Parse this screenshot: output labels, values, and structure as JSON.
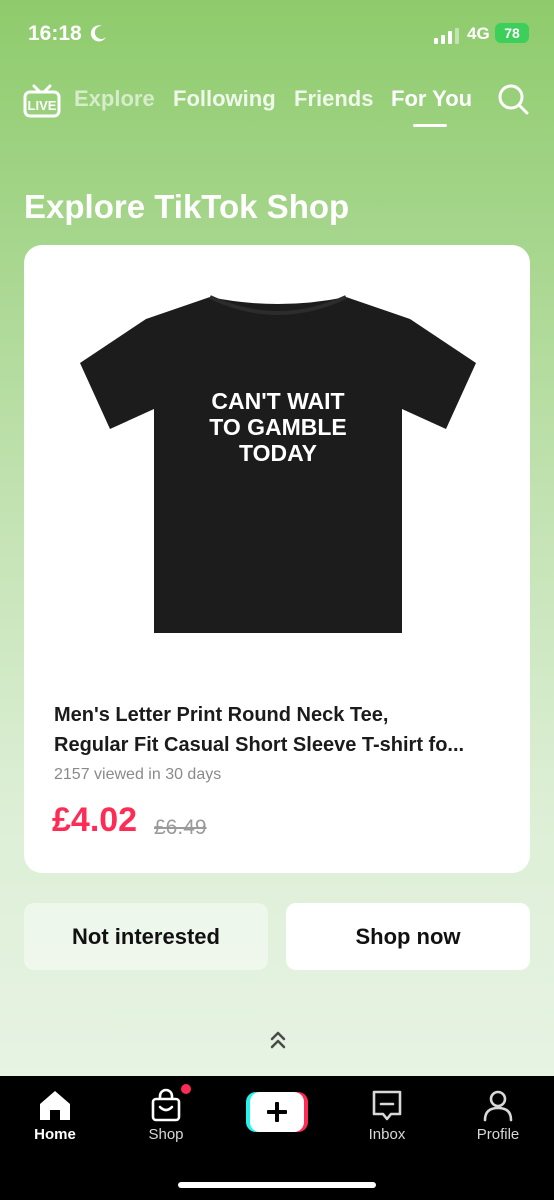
{
  "status_bar": {
    "time": "16:18",
    "network": "4G",
    "battery": "78"
  },
  "top_nav": {
    "live_label": "LIVE",
    "tabs": [
      "Explore",
      "Following",
      "Friends",
      "For You"
    ],
    "active_tab": "For You"
  },
  "heading": "Explore TikTok Shop",
  "product": {
    "image_text": [
      "CAN'T WAIT",
      "TO GAMBLE",
      "TODAY"
    ],
    "title_lines": [
      "Men's Letter  Print Round Neck Tee,",
      "Regular Fit Casual Short Sleeve T-shirt fo..."
    ],
    "views": "2157 viewed in 30 days",
    "price": "£4.02",
    "original_price": "£6.49"
  },
  "buttons": {
    "not_interested": "Not interested",
    "shop_now": "Shop now"
  },
  "bottom_nav": {
    "home": "Home",
    "shop": "Shop",
    "inbox": "Inbox",
    "profile": "Profile"
  },
  "colors": {
    "accent": "#fe2c55",
    "background_top": "#8fcb6c",
    "nav_bg": "#000000"
  }
}
